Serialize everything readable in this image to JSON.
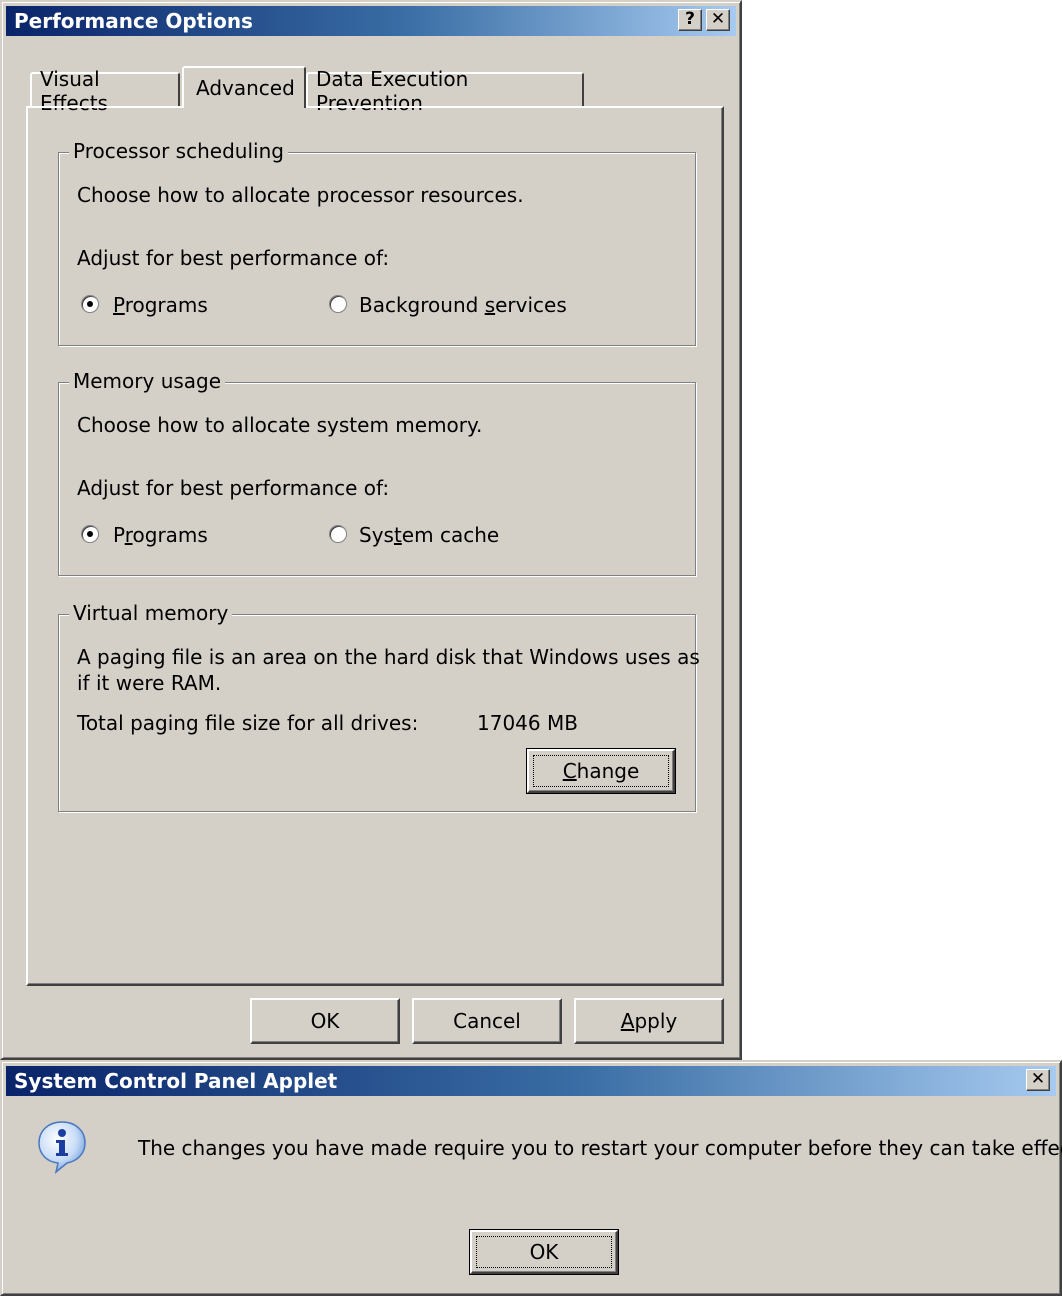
{
  "perf_dialog": {
    "title": "Performance Options",
    "help_button": "?",
    "close_button": "✕",
    "tabs": [
      "Visual Effects",
      "Advanced",
      "Data Execution Prevention"
    ],
    "active_tab": "Advanced",
    "processor": {
      "legend": "Processor scheduling",
      "description": "Choose how to allocate processor resources.",
      "adjust": "Adjust for best performance of:",
      "option1": {
        "pre": "",
        "key": "P",
        "post": "rograms",
        "selected": true
      },
      "option2": {
        "pre": "Background ",
        "key": "s",
        "post": "ervices",
        "selected": false
      }
    },
    "memory": {
      "legend": "Memory usage",
      "description": "Choose how to allocate system memory.",
      "adjust": "Adjust for best performance of:",
      "option1": {
        "pre": "P",
        "key": "r",
        "post": "ograms",
        "selected": true
      },
      "option2": {
        "pre": "Sys",
        "key": "t",
        "post": "em cache",
        "selected": false
      }
    },
    "virtual": {
      "legend": "Virtual memory",
      "description_line1": "A paging file is an area on the hard disk that Windows uses as",
      "description_line2": "if it were RAM.",
      "total_label": "Total paging file size for all drives:",
      "total_value": "17046 MB",
      "change_button": {
        "key": "C",
        "post": "hange"
      }
    },
    "footer": {
      "ok": "OK",
      "cancel": "Cancel",
      "apply": {
        "key": "A",
        "post": "pply"
      }
    }
  },
  "applet_dialog": {
    "title": "System Control Panel Applet",
    "close_button": "✕",
    "icon": "info-icon",
    "message": "The changes you have made require you to restart your computer before they can take effect.",
    "ok": "OK"
  }
}
